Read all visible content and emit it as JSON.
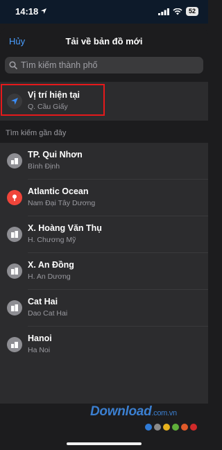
{
  "status_bar": {
    "time": "14:18",
    "battery": "52",
    "location_icon": "location-arrow-icon",
    "signal_icon": "cellular-signal-icon",
    "wifi_icon": "wifi-icon"
  },
  "header": {
    "cancel_label": "Hủy",
    "title": "Tải về bản đồ mới"
  },
  "search": {
    "placeholder": "Tìm kiếm thành phố",
    "icon": "search-icon"
  },
  "current_location": {
    "title": "Vị trí hiện tại",
    "subtitle": "Q. Cầu Giấy",
    "icon": "location-arrow-icon",
    "icon_color": "#3b8cf5",
    "highlight_color": "#e6191b"
  },
  "recent": {
    "section_label": "Tìm kiếm gần đây",
    "items": [
      {
        "title": "TP. Qui Nhơn",
        "subtitle": "Bình Định",
        "icon": "city-icon",
        "icon_color": "#8e8e93"
      },
      {
        "title": "Atlantic Ocean",
        "subtitle": "Nam Đại Tây Dương",
        "icon": "pin-icon",
        "icon_color": "#f0453a"
      },
      {
        "title": "X. Hoàng Văn Thụ",
        "subtitle": "H. Chương Mỹ",
        "icon": "building-icon",
        "icon_color": "#8e8e93"
      },
      {
        "title": "X. An Đồng",
        "subtitle": "H. An Dương",
        "icon": "building-icon",
        "icon_color": "#8e8e93"
      },
      {
        "title": "Cat Hai",
        "subtitle": "Dao Cat Hai",
        "icon": "building-icon",
        "icon_color": "#8e8e93"
      },
      {
        "title": "Hanoi",
        "subtitle": "Ha Noi",
        "icon": "city-icon",
        "icon_color": "#8e8e93"
      }
    ]
  },
  "watermark": {
    "name": "Download",
    "tld": ".com.vn",
    "dot_colors": [
      "#2f7ad6",
      "#8a8a8a",
      "#e8b21d",
      "#5fae3a",
      "#e05a2a",
      "#d02a2a"
    ]
  },
  "colors": {
    "accent": "#4a9eff",
    "background": "#1c1c1e",
    "row_background": "#2c2c2e"
  }
}
